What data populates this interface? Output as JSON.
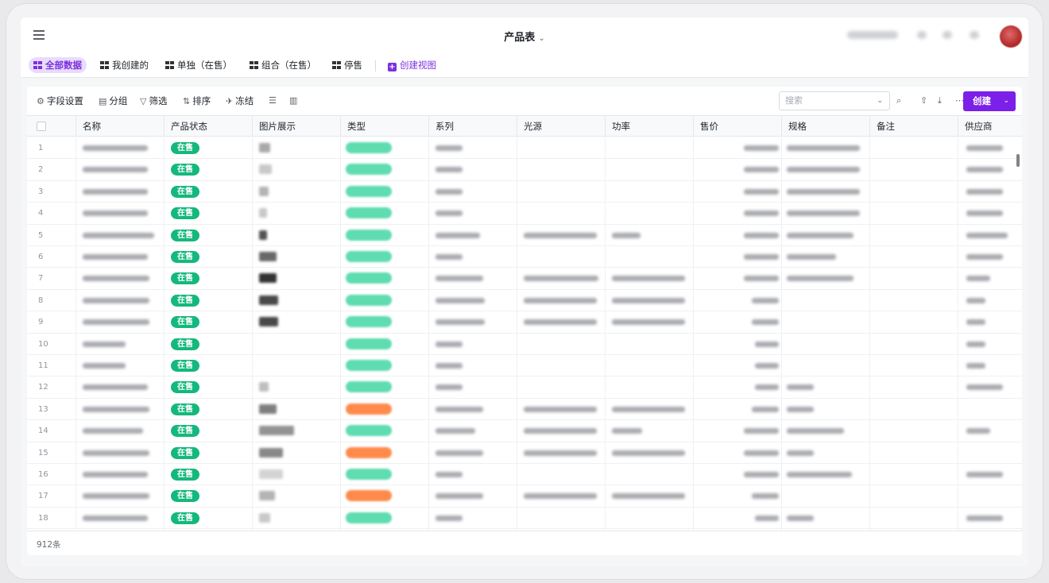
{
  "window": {
    "title": "产品表"
  },
  "view_tabs": [
    {
      "label": "全部数据",
      "active": true
    },
    {
      "label": "我创建的",
      "active": false
    },
    {
      "label": "单独（在售）",
      "active": false
    },
    {
      "label": "组合（在售）",
      "active": false
    },
    {
      "label": "停售",
      "active": false
    }
  ],
  "create_view_label": "创建视图",
  "toolbar": {
    "field_settings": "字段设置",
    "group": "分组",
    "filter": "筛选",
    "sort": "排序",
    "freeze": "冻结",
    "search_placeholder": "搜索",
    "create_label": "创建"
  },
  "table": {
    "columns": [
      "名称",
      "产品状态",
      "图片展示",
      "类型",
      "系列",
      "光源",
      "功率",
      "售价",
      "规格",
      "备注",
      "供应商"
    ],
    "status_label": "在售",
    "row_numbers": [
      "1",
      "2",
      "3",
      "4",
      "5",
      "6",
      "7",
      "8",
      "9",
      "10",
      "11",
      "12",
      "13",
      "14",
      "15",
      "16",
      "17",
      "18"
    ],
    "type_colors": [
      "green",
      "green",
      "green",
      "green",
      "green",
      "green",
      "green",
      "green",
      "green",
      "green",
      "green",
      "green",
      "orange",
      "green",
      "orange",
      "green",
      "orange",
      "green"
    ],
    "total": "912条"
  },
  "colors": {
    "accent": "#7c1fe8",
    "status_green": "#14b87c",
    "type_green": "#5fdcb0",
    "type_orange": "#ff8a4c"
  }
}
